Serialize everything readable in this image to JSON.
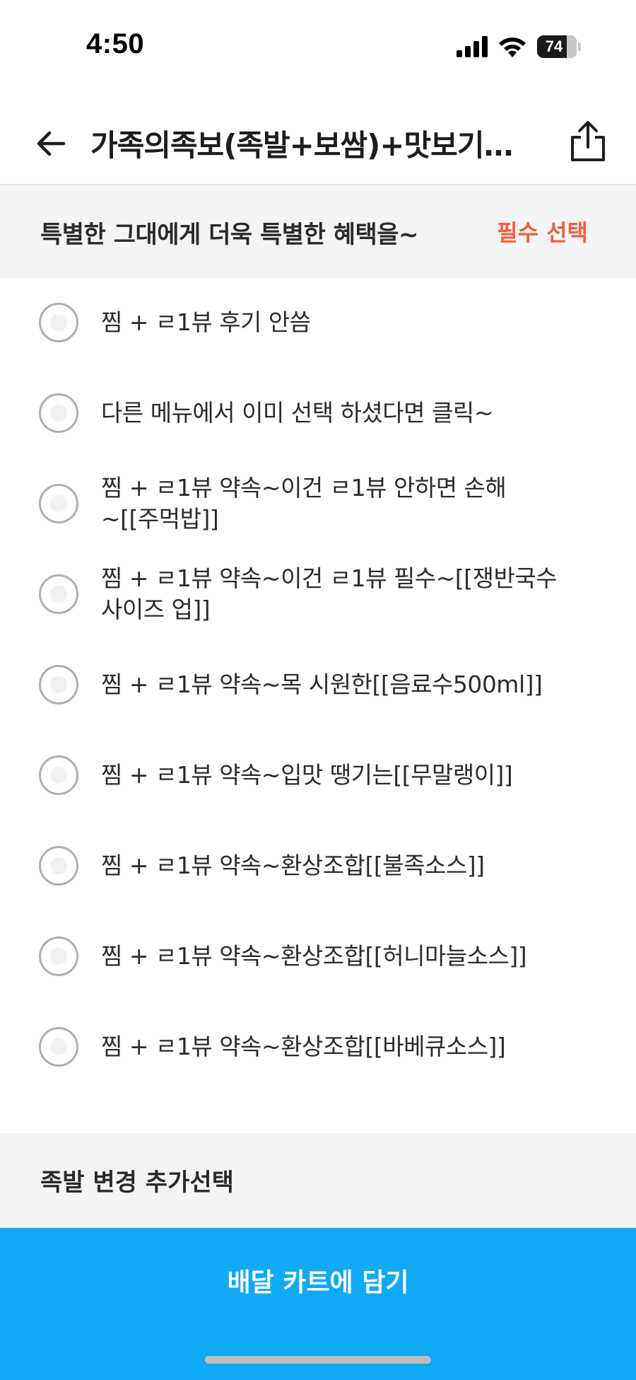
{
  "status_bar": {
    "time": "4:50",
    "battery": "74",
    "icons": [
      "signal-icon",
      "wifi-icon",
      "battery-icon"
    ]
  },
  "header": {
    "title": "가족의족보(족발+보쌈)+맛보기…",
    "back_icon": "back-arrow-icon",
    "share_icon": "share-icon"
  },
  "option_group": {
    "title": "특별한 그대에게 더욱 특별한 혜택을~",
    "badge": "필수 선택",
    "badge_color": "#f2603a",
    "options": [
      {
        "lines": [
          "찜 + ㄹ1뷰 후기 안씀"
        ]
      },
      {
        "lines": [
          "다른 메뉴에서 이미 선택 하셨다면 클릭~"
        ]
      },
      {
        "lines": [
          "찜 + ㄹ1뷰 약속~이건 ㄹ1뷰 안하면 손해",
          "~[[주먹밥]]"
        ]
      },
      {
        "lines": [
          "찜 + ㄹ1뷰 약속~이건 ㄹ1뷰 필수~[[쟁반국수",
          "사이즈 업]]"
        ]
      },
      {
        "lines": [
          "찜 + ㄹ1뷰 약속~목 시원한[[음료수500ml]]"
        ]
      },
      {
        "lines": [
          "찜 + ㄹ1뷰 약속~입맛 땡기는[[무말랭이]]"
        ]
      },
      {
        "lines": [
          "찜 + ㄹ1뷰 약속~환상조합[[불족소스]]"
        ]
      },
      {
        "lines": [
          "찜 + ㄹ1뷰 약속~환상조합[[허니마늘소스]]"
        ]
      },
      {
        "lines": [
          "찜 + ㄹ1뷰 약속~환상조합[[바베큐소스]]"
        ]
      }
    ]
  },
  "option_group_2": {
    "title": "족발 변경 추가선택"
  },
  "cta": {
    "label": "배달 카트에 담기",
    "color": "#10aaf4"
  }
}
